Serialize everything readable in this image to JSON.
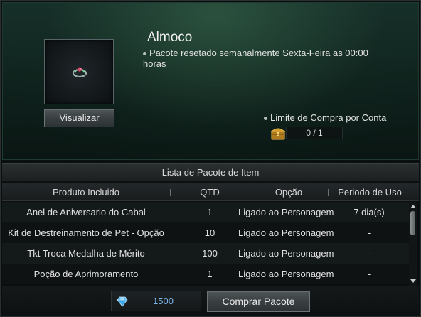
{
  "package": {
    "title": "Almoco",
    "reset_info": "Pacote resetado semanalmente Sexta-Feira as 00:00 horas",
    "view_button": "Visualizar",
    "item_icon": "ring-icon",
    "purchase_limit_label": "Limite de Compra por Conta",
    "purchase_limit_value": "0 / 1",
    "limit_icon": "treasure-chest-icon"
  },
  "list": {
    "title": "Lista de Pacote de Item",
    "columns": [
      "Produto Incluido",
      "QTD",
      "Opção",
      "Periodo de Uso"
    ],
    "rows": [
      {
        "product": "Anel de Aniversario do Cabal",
        "qty": "1",
        "option": "Ligado ao Personagem",
        "period": "7 dia(s)"
      },
      {
        "product": "Kit de Destreinamento de Pet - Opção",
        "qty": "10",
        "option": "Ligado ao Personagem",
        "period": "-"
      },
      {
        "product": "Tkt Troca Medalha de Mérito",
        "qty": "100",
        "option": "Ligado ao Personagem",
        "period": "-"
      },
      {
        "product": "Poção de Aprimoramento",
        "qty": "1",
        "option": "Ligado ao Personagem",
        "period": "-"
      }
    ]
  },
  "purchase": {
    "price": "1500",
    "currency_icon": "diamond-gem-icon",
    "buy_button": "Comprar Pacote"
  },
  "colors": {
    "price_text": "#7fb8f0",
    "panel_green": "#17302a"
  }
}
